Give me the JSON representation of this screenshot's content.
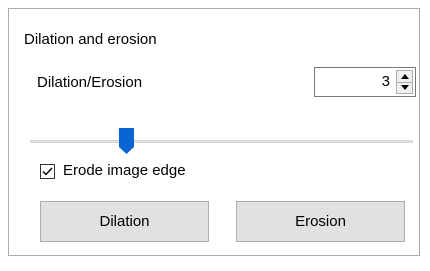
{
  "group": {
    "title": "Dilation and erosion"
  },
  "parameter": {
    "label": "Dilation/Erosion",
    "value": "3"
  },
  "slider": {
    "level_fraction": 0.24
  },
  "checkbox": {
    "label": "Erode image edge",
    "checked": true
  },
  "buttons": {
    "dilation_label": "Dilation",
    "erosion_label": "Erosion"
  },
  "colors": {
    "slider_thumb": "#0a64d4",
    "button_face": "#e1e1e1",
    "border": "#adadad"
  },
  "icons": {
    "spin_up": "triangle-up-icon",
    "spin_down": "triangle-down-icon",
    "check": "checkmark-icon"
  }
}
